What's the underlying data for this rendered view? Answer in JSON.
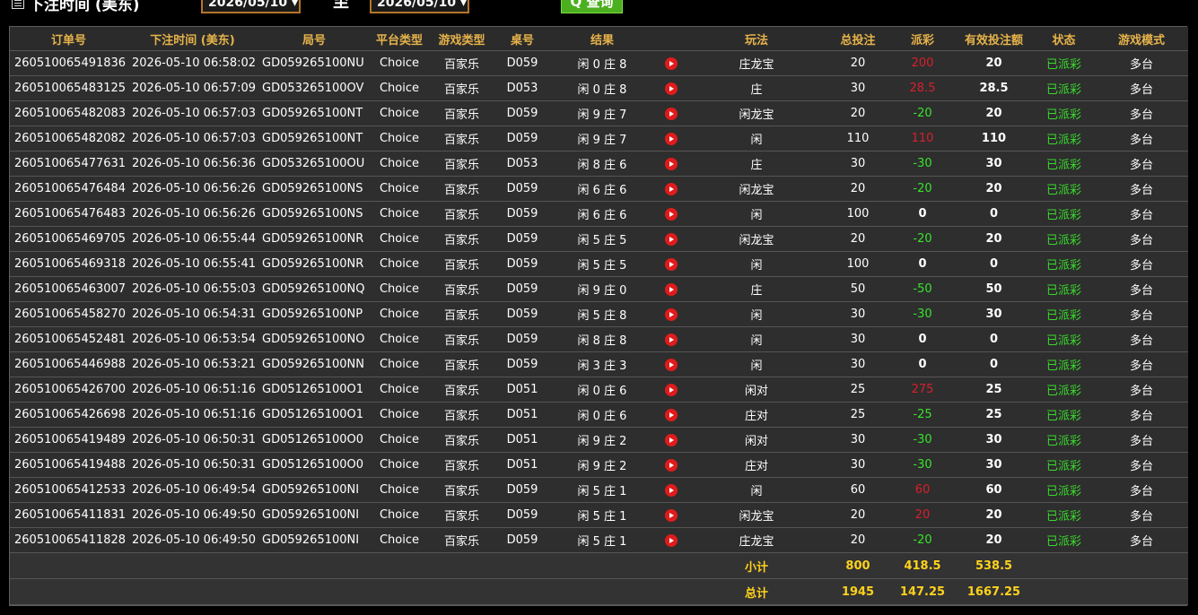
{
  "filter": {
    "label": "下注时间 (美东)",
    "date_from": "2026/05/10 ▾",
    "to_separator": "至",
    "date_to": "2026/05/10 ▾",
    "query_button": "Q 查询"
  },
  "table": {
    "headers": [
      "订单号",
      "下注时间 (美东)",
      "局号",
      "平台类型",
      "游戏类型",
      "桌号",
      "结果",
      "",
      "玩法",
      "总投注",
      "派彩",
      "有效投注额",
      "状态",
      "游戏模式"
    ],
    "rows": [
      [
        "260510065491836",
        "2026-05-10 06:58:02",
        "GD059265100NU",
        "Choice",
        "百家乐",
        "D059",
        "闲 0 庄 8",
        "庄龙宝",
        "20",
        "200",
        "20",
        "已派彩",
        "多台"
      ],
      [
        "260510065483125",
        "2026-05-10 06:57:09",
        "GD053265100OV",
        "Choice",
        "百家乐",
        "D053",
        "闲 0 庄 8",
        "庄",
        "30",
        "28.5",
        "28.5",
        "已派彩",
        "多台"
      ],
      [
        "260510065482083",
        "2026-05-10 06:57:03",
        "GD059265100NT",
        "Choice",
        "百家乐",
        "D059",
        "闲 9 庄 7",
        "闲龙宝",
        "20",
        "-20",
        "20",
        "已派彩",
        "多台"
      ],
      [
        "260510065482082",
        "2026-05-10 06:57:03",
        "GD059265100NT",
        "Choice",
        "百家乐",
        "D059",
        "闲 9 庄 7",
        "闲",
        "110",
        "110",
        "110",
        "已派彩",
        "多台"
      ],
      [
        "260510065477631",
        "2026-05-10 06:56:36",
        "GD053265100OU",
        "Choice",
        "百家乐",
        "D053",
        "闲 8 庄 6",
        "庄",
        "30",
        "-30",
        "30",
        "已派彩",
        "多台"
      ],
      [
        "260510065476484",
        "2026-05-10 06:56:26",
        "GD059265100NS",
        "Choice",
        "百家乐",
        "D059",
        "闲 6 庄 6",
        "闲龙宝",
        "20",
        "-20",
        "20",
        "已派彩",
        "多台"
      ],
      [
        "260510065476483",
        "2026-05-10 06:56:26",
        "GD059265100NS",
        "Choice",
        "百家乐",
        "D059",
        "闲 6 庄 6",
        "闲",
        "100",
        "0",
        "0",
        "已派彩",
        "多台"
      ],
      [
        "260510065469705",
        "2026-05-10 06:55:44",
        "GD059265100NR",
        "Choice",
        "百家乐",
        "D059",
        "闲 5 庄 5",
        "闲龙宝",
        "20",
        "-20",
        "20",
        "已派彩",
        "多台"
      ],
      [
        "260510065469318",
        "2026-05-10 06:55:41",
        "GD059265100NR",
        "Choice",
        "百家乐",
        "D059",
        "闲 5 庄 5",
        "闲",
        "100",
        "0",
        "0",
        "已派彩",
        "多台"
      ],
      [
        "260510065463007",
        "2026-05-10 06:55:03",
        "GD059265100NQ",
        "Choice",
        "百家乐",
        "D059",
        "闲 9 庄 0",
        "庄",
        "50",
        "-50",
        "50",
        "已派彩",
        "多台"
      ],
      [
        "260510065458270",
        "2026-05-10 06:54:31",
        "GD059265100NP",
        "Choice",
        "百家乐",
        "D059",
        "闲 5 庄 8",
        "闲",
        "30",
        "-30",
        "30",
        "已派彩",
        "多台"
      ],
      [
        "260510065452481",
        "2026-05-10 06:53:54",
        "GD059265100NO",
        "Choice",
        "百家乐",
        "D059",
        "闲 8 庄 8",
        "闲",
        "30",
        "0",
        "0",
        "已派彩",
        "多台"
      ],
      [
        "260510065446988",
        "2026-05-10 06:53:21",
        "GD059265100NN",
        "Choice",
        "百家乐",
        "D059",
        "闲 3 庄 3",
        "闲",
        "30",
        "0",
        "0",
        "已派彩",
        "多台"
      ],
      [
        "260510065426700",
        "2026-05-10 06:51:16",
        "GD051265100O1",
        "Choice",
        "百家乐",
        "D051",
        "闲 0 庄 6",
        "闲对",
        "25",
        "275",
        "25",
        "已派彩",
        "多台"
      ],
      [
        "260510065426698",
        "2026-05-10 06:51:16",
        "GD051265100O1",
        "Choice",
        "百家乐",
        "D051",
        "闲 0 庄 6",
        "庄对",
        "25",
        "-25",
        "25",
        "已派彩",
        "多台"
      ],
      [
        "260510065419489",
        "2026-05-10 06:50:31",
        "GD051265100O0",
        "Choice",
        "百家乐",
        "D051",
        "闲 9 庄 2",
        "闲对",
        "30",
        "-30",
        "30",
        "已派彩",
        "多台"
      ],
      [
        "260510065419488",
        "2026-05-10 06:50:31",
        "GD051265100O0",
        "Choice",
        "百家乐",
        "D051",
        "闲 9 庄 2",
        "庄对",
        "30",
        "-30",
        "30",
        "已派彩",
        "多台"
      ],
      [
        "260510065412533",
        "2026-05-10 06:49:54",
        "GD059265100NI",
        "Choice",
        "百家乐",
        "D059",
        "闲 5 庄 1",
        "闲",
        "60",
        "60",
        "60",
        "已派彩",
        "多台"
      ],
      [
        "260510065411831",
        "2026-05-10 06:49:50",
        "GD059265100NI",
        "Choice",
        "百家乐",
        "D059",
        "闲 5 庄 1",
        "闲龙宝",
        "20",
        "20",
        "20",
        "已派彩",
        "多台"
      ],
      [
        "260510065411828",
        "2026-05-10 06:49:50",
        "GD059265100NI",
        "Choice",
        "百家乐",
        "D059",
        "闲 5 庄 1",
        "庄龙宝",
        "20",
        "-20",
        "20",
        "已派彩",
        "多台"
      ]
    ],
    "subtotal": {
      "label": "小计",
      "total_bet": "800",
      "payout": "418.5",
      "valid_bet": "538.5"
    },
    "grand_total": {
      "label": "总计",
      "total_bet": "1945",
      "payout": "147.25",
      "valid_bet": "1667.25"
    }
  },
  "colors": {
    "header_text": "#e6b34a",
    "negative_payout": "#37e32b",
    "positive_payout": "#d7202c",
    "status_text": "#39d92c",
    "totals_text": "#ffd21c",
    "date_border": "#b5762a",
    "query_button": "#4caf1f"
  },
  "icons": {
    "result_video": "play-circle-icon",
    "calendar": "calendar-icon"
  }
}
